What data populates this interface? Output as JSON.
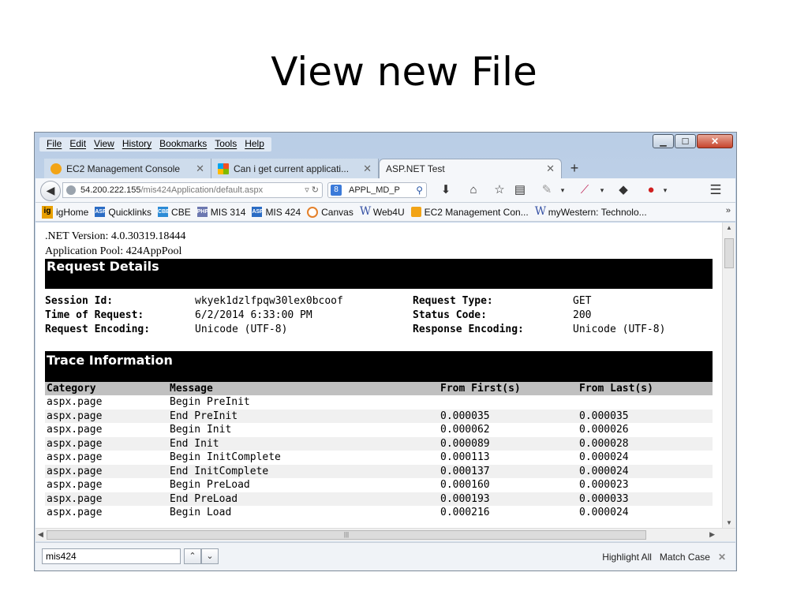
{
  "slide": {
    "title": "View new File"
  },
  "menu": [
    "File",
    "Edit",
    "View",
    "History",
    "Bookmarks",
    "Tools",
    "Help"
  ],
  "tabs": [
    {
      "label": "EC2 Management Console",
      "icon": "cube-icon"
    },
    {
      "label": "Can i get current applicati...",
      "icon": "windows-logo-icon"
    },
    {
      "label": "ASP.NET Test",
      "icon": ""
    }
  ],
  "nav": {
    "url_host": "54.200.222.155",
    "url_path": "/mis424Application/default.aspx",
    "search_engine_glyph": "8",
    "search_text": "APPL_MD_P"
  },
  "bookmarks": [
    {
      "label": "igHome",
      "icon": "ig"
    },
    {
      "label": "Quicklinks",
      "icon": "ASP"
    },
    {
      "label": "CBE",
      "icon": "CBE"
    },
    {
      "label": "MIS 314",
      "icon": "PHP"
    },
    {
      "label": "MIS 424",
      "icon": "ASP"
    },
    {
      "label": "Canvas",
      "icon": "canvas"
    },
    {
      "label": "Web4U",
      "icon": "W"
    },
    {
      "label": "EC2 Management Con...",
      "icon": "cube"
    },
    {
      "label": "myWestern: Technolo...",
      "icon": "W"
    }
  ],
  "page": {
    "net_version": ".NET Version: 4.0.30319.18444",
    "app_pool": "Application Pool: 424AppPool",
    "request_details_title": "Request Details",
    "details_left": [
      {
        "label": "Session Id:",
        "value": "wkyek1dzlfpqw30lex0bcoof"
      },
      {
        "label": "Time of Request:",
        "value": "6/2/2014 6:33:00 PM"
      },
      {
        "label": "Request Encoding:",
        "value": "Unicode (UTF-8)"
      }
    ],
    "details_right": [
      {
        "label": "Request Type:",
        "value": "GET"
      },
      {
        "label": "Status Code:",
        "value": "200"
      },
      {
        "label": "Response Encoding:",
        "value": "Unicode (UTF-8)"
      }
    ],
    "trace_title": "Trace Information",
    "trace_headers": [
      "Category",
      "Message",
      "From First(s)",
      "From Last(s)"
    ],
    "trace_rows": [
      [
        "aspx.page",
        "Begin PreInit",
        "",
        ""
      ],
      [
        "aspx.page",
        "End PreInit",
        "0.000035",
        "0.000035"
      ],
      [
        "aspx.page",
        "Begin Init",
        "0.000062",
        "0.000026"
      ],
      [
        "aspx.page",
        "End Init",
        "0.000089",
        "0.000028"
      ],
      [
        "aspx.page",
        "Begin InitComplete",
        "0.000113",
        "0.000024"
      ],
      [
        "aspx.page",
        "End InitComplete",
        "0.000137",
        "0.000024"
      ],
      [
        "aspx.page",
        "Begin PreLoad",
        "0.000160",
        "0.000023"
      ],
      [
        "aspx.page",
        "End PreLoad",
        "0.000193",
        "0.000033"
      ],
      [
        "aspx.page",
        "Begin Load",
        "0.000216",
        "0.000024"
      ]
    ]
  },
  "findbar": {
    "query": "mis424",
    "highlight_all": "Highlight All",
    "match_case": "Match Case"
  }
}
